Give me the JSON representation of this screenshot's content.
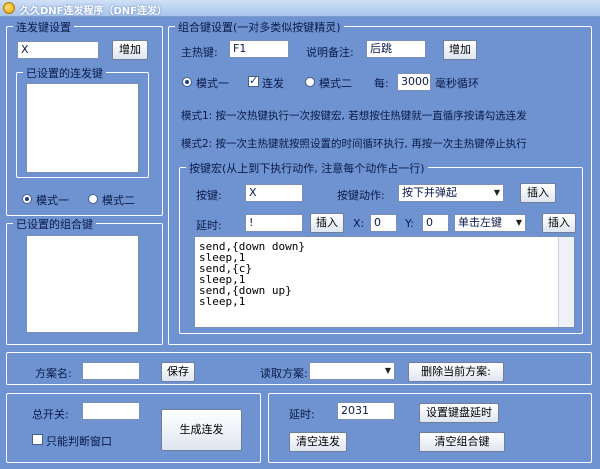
{
  "window": {
    "title": "久久DNF连发程序（DNF连发）"
  },
  "repeat_group": {
    "title": "连发键设置",
    "key_value": "X",
    "add_button": "增加",
    "set_keys_title": "已设置的连发键",
    "mode1": "模式一",
    "mode2": "模式二"
  },
  "combo_list_group": {
    "title": "已设置的组合键"
  },
  "combo_group": {
    "title": "组合键设置(一对多类似按键精灵)",
    "hotkey_label": "主热键:",
    "hotkey_value": "F1",
    "remark_label": "说明备注:",
    "remark_value": "后跳",
    "add_button": "增加",
    "mode1": "模式一",
    "repeat": "连发",
    "mode2": "模式二",
    "every_label": "每:",
    "interval_value": "3000",
    "ms_label": "毫秒循环",
    "desc1": "模式1: 按一次热键执行一次按键宏, 若想按住热键就一直循序按请勾选连发",
    "desc2": "模式2: 按一次主热键就按照设置的时间循环执行, 再按一次主热键停止执行"
  },
  "macro_group": {
    "title": "按键宏(从上到下执行动作, 注意每个动作占一行)",
    "key_label": "按键:",
    "key_value": "X",
    "action_label": "按键动作:",
    "action_value": "按下并弹起",
    "insert1": "插入",
    "delay_label": "延时:",
    "delay_value": "!",
    "insert2": "插入",
    "x_label": "X:",
    "x_value": "0",
    "y_label": "Y:",
    "y_value": "0",
    "mouse_value": "单击左键",
    "insert3": "插入",
    "macro_text": "send,{down down}\nsleep,1\nsend,{c}\nsleep,1\nsend,{down up}\nsleep,1"
  },
  "plan_bar": {
    "plan_name_label": "方案名:",
    "plan_name_value": "",
    "save_button": "保存",
    "read_label": "读取方案:",
    "read_value": "",
    "delete_button": "删除当前方案:"
  },
  "bottom_left": {
    "switch_label": "总开关:",
    "switch_value": "",
    "window_check": "只能判断窗口",
    "generate_button": "生成连发"
  },
  "bottom_right": {
    "delay_label": "延时:",
    "delay_value": "2031",
    "set_delay_button": "设置键盘延时",
    "clear_repeat_button": "清空连发",
    "clear_combo_button": "清空组合键"
  }
}
